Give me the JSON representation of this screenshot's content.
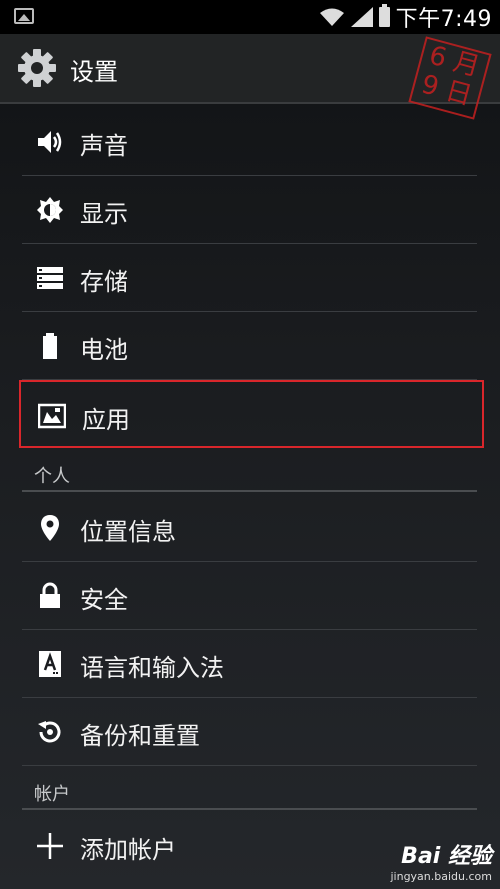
{
  "status_bar": {
    "time": "下午7:49"
  },
  "header": {
    "title": "设置",
    "stamp_text": "6 月\n9 日"
  },
  "items_top": [
    {
      "label": "声音",
      "icon": "volume-icon"
    },
    {
      "label": "显示",
      "icon": "brightness-icon"
    },
    {
      "label": "存储",
      "icon": "storage-icon"
    },
    {
      "label": "电池",
      "icon": "battery-icon"
    },
    {
      "label": "应用",
      "icon": "apps-icon",
      "highlighted": true
    }
  ],
  "sections": {
    "personal": "个人",
    "accounts": "帐户"
  },
  "items_personal": [
    {
      "label": "位置信息",
      "icon": "location-icon"
    },
    {
      "label": "安全",
      "icon": "lock-icon"
    },
    {
      "label": "语言和输入法",
      "icon": "language-icon"
    },
    {
      "label": "备份和重置",
      "icon": "backup-icon"
    }
  ],
  "items_accounts": [
    {
      "label": "添加帐户",
      "icon": "add-icon"
    }
  ],
  "watermark": {
    "brand": "Bai 经验",
    "url": "jingyan.baidu.com"
  }
}
